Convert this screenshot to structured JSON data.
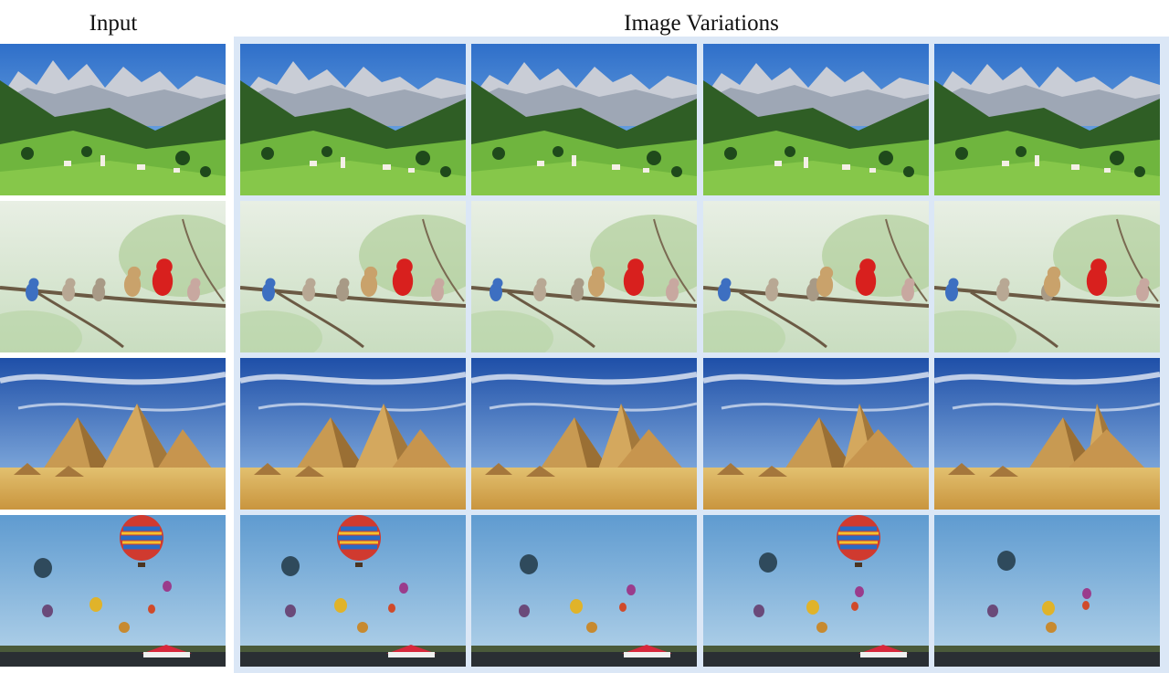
{
  "figure": {
    "input_header": "Input",
    "variations_header": "Image Variations"
  },
  "rows": [
    {
      "scene": "mountains",
      "label_key": "mountain-valley-scene"
    },
    {
      "scene": "birds",
      "label_key": "birds-on-branch-scene"
    },
    {
      "scene": "pyramids",
      "label_key": "pyramids-desert-scene"
    },
    {
      "scene": "balloons",
      "label_key": "hot-air-balloons-scene"
    }
  ],
  "columns": [
    {
      "role": "input"
    },
    {
      "role": "variation"
    },
    {
      "role": "variation"
    },
    {
      "role": "variation"
    },
    {
      "role": "variation"
    }
  ],
  "colors": {
    "panel_bg": "#dbe7f6",
    "sky_blue": "#3f7fd0",
    "grass_green": "#5aa83a",
    "sand": "#d9b05a"
  }
}
